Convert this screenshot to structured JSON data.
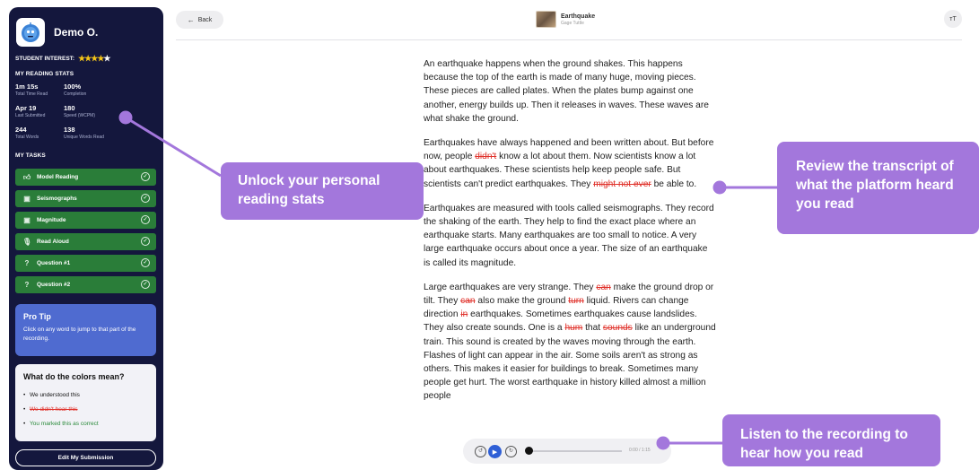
{
  "sidebar": {
    "username": "Demo O.",
    "student_interest_label": "STUDENT INTEREST:",
    "interest_rating": 5,
    "stats_title": "MY READING STATS",
    "stats": [
      {
        "value": "1m 15s",
        "label": "Total Time Read"
      },
      {
        "value": "100%",
        "label": "Completion"
      },
      {
        "value": "Apr 19",
        "label": "Last Submitted"
      },
      {
        "value": "180",
        "label": "Speed (WCPM)"
      },
      {
        "value": "244",
        "label": "Total Words"
      },
      {
        "value": "138",
        "label": "Unique Words Read"
      }
    ],
    "tasks_title": "MY TASKS",
    "tasks": [
      {
        "label": "Model Reading",
        "icon": "thumbs-up-icon"
      },
      {
        "label": "Seismographs",
        "icon": "book-icon"
      },
      {
        "label": "Magnitude",
        "icon": "book-icon"
      },
      {
        "label": "Read Aloud",
        "icon": "microphone-icon"
      },
      {
        "label": "Question #1",
        "icon": "question-icon"
      },
      {
        "label": "Question #2",
        "icon": "question-icon"
      }
    ],
    "pro_tip": {
      "title": "Pro Tip",
      "body": "Click on any word to jump to that part of the recording."
    },
    "colors_legend": {
      "title": "What do the colors mean?",
      "items": [
        {
          "text": "We understood this",
          "color": "#111111"
        },
        {
          "text": "We didn't hear this",
          "color": "#e0322b"
        },
        {
          "text": "You marked this as correct",
          "color": "#2a8a3a"
        }
      ]
    },
    "edit_button": "Edit My Submission"
  },
  "topbar": {
    "back_label": "Back",
    "book_title": "Earthquake",
    "book_author": "Gage Tuttle",
    "font_button": "тT"
  },
  "article": {
    "paragraphs": [
      [
        {
          "t": "An earthquake happens when the ground shakes. This happens because the top of the earth is made of many huge, moving pieces. These pieces are called plates. When the plates bump against one another, energy builds up. Then it releases in waves. These waves are what shake the ground."
        }
      ],
      [
        {
          "t": "Earthquakes have always happened and been written about. But before now, people "
        },
        {
          "t": "didn't",
          "miss": true
        },
        {
          "t": " know a lot about them. Now scientists know a lot about earthquakes. These scientists help keep people safe. But scientists can't predict earthquakes. They "
        },
        {
          "t": "might not ever",
          "miss": true
        },
        {
          "t": " be able to."
        }
      ],
      [
        {
          "t": "Earthquakes are measured with tools called seismographs. They record the shaking of the earth. They help to find the exact place where an earthquake starts. Many earthquakes are too small to notice. A very large earthquake occurs about once a year. The size of an earthquake is called its magnitude."
        }
      ],
      [
        {
          "t": "Large earthquakes are very strange. They "
        },
        {
          "t": "can",
          "miss": true
        },
        {
          "t": " make the ground drop or tilt. They "
        },
        {
          "t": "can",
          "miss": true
        },
        {
          "t": " also make the ground "
        },
        {
          "t": "turn",
          "miss": true
        },
        {
          "t": " liquid. Rivers can change direction "
        },
        {
          "t": "in",
          "miss": true
        },
        {
          "t": " earthquakes. Sometimes earthquakes cause landslides. They also create sounds. One is a "
        },
        {
          "t": "hum",
          "miss": true
        },
        {
          "t": " that "
        },
        {
          "t": "sounds",
          "miss": true
        },
        {
          "t": " like an underground train. This sound is created by the waves moving through the earth. Flashes of light can appear in the air. Some soils aren't as strong as others. This makes it easier for buildings to break. Sometimes many people get hurt. The worst earthquake in history killed almost a million people"
        }
      ]
    ]
  },
  "player": {
    "time": "0:00 / 1:15",
    "progress": 0
  },
  "callouts": {
    "stats": "Unlock your personal reading stats",
    "transcript": "Review the transcript of what the platform heard you read",
    "recording": "Listen to the recording to hear how you read"
  },
  "colors": {
    "sidebar_bg": "#14173d",
    "task_green": "#2a7d39",
    "callout_purple": "#a377dc",
    "missed_red": "#e0322b",
    "play_blue": "#2f5fd6"
  }
}
